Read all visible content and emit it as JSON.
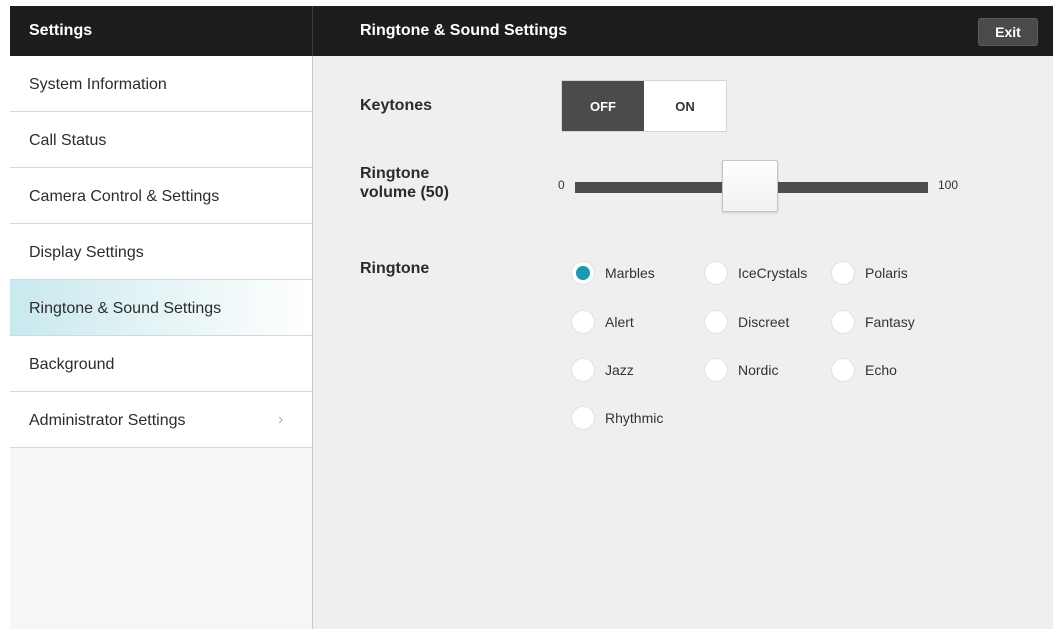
{
  "header": {
    "left_title": "Settings",
    "main_title": "Ringtone & Sound Settings",
    "exit_label": "Exit"
  },
  "sidebar": {
    "items": [
      {
        "label": "System Information"
      },
      {
        "label": "Call Status"
      },
      {
        "label": "Camera Control & Settings"
      },
      {
        "label": "Display Settings"
      },
      {
        "label": "Ringtone & Sound Settings",
        "active": true
      },
      {
        "label": "Background"
      },
      {
        "label": "Administrator Settings",
        "chevron": "›"
      }
    ]
  },
  "keytones": {
    "label": "Keytones",
    "off_label": "OFF",
    "on_label": "ON",
    "selected": "OFF"
  },
  "volume": {
    "label_line1": "Ringtone",
    "label_line2": "volume (50)",
    "min_label": "0",
    "max_label": "100",
    "value": 50
  },
  "ringtone": {
    "label": "Ringtone",
    "options": [
      "Marbles",
      "IceCrystals",
      "Polaris",
      "Alert",
      "Discreet",
      "Fantasy",
      "Jazz",
      "Nordic",
      "Echo",
      "Rhythmic"
    ],
    "selected": "Marbles"
  },
  "colors": {
    "topbar": "#1d1d1d",
    "accent": "#1a9ab0",
    "active_item": "#c7e9ee"
  }
}
